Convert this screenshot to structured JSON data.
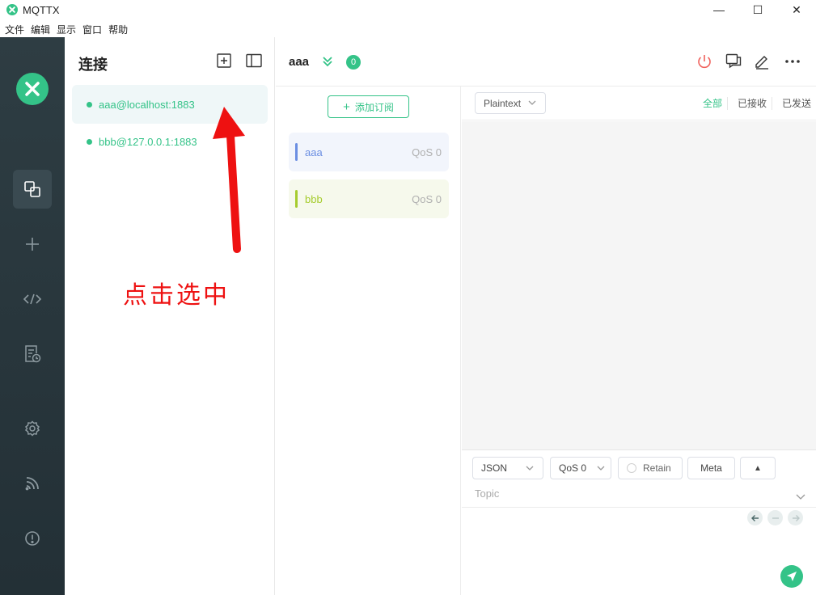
{
  "window": {
    "title": "MQTTX",
    "minimize": "—",
    "maximize": "☐",
    "close": "✕"
  },
  "menu": [
    "文件",
    "编辑",
    "显示",
    "窗口",
    "帮助"
  ],
  "sidebar": {
    "items": [
      "connections-icon",
      "add-icon",
      "script-icon",
      "log-icon",
      "settings-icon",
      "feed-icon",
      "about-icon"
    ]
  },
  "connections": {
    "title": "连接",
    "items": [
      {
        "label": "aaa@localhost:1883",
        "active": true
      },
      {
        "label": "bbb@127.0.0.1:1883",
        "active": false
      }
    ]
  },
  "annotation": {
    "text": "点击选中",
    "color": "#ee1111"
  },
  "main": {
    "title": "aaa",
    "badge": "0",
    "add_subscription": "添加订阅",
    "subscriptions": [
      {
        "topic": "aaa",
        "qos": "QoS 0",
        "color": "#6b8ee2",
        "bg": "#f2f5fc"
      },
      {
        "topic": "bbb",
        "qos": "QoS 0",
        "color": "#a6cc2e",
        "bg": "#f6f9ec"
      }
    ],
    "format": "Plaintext",
    "filters": {
      "all": "全部",
      "received": "已接收",
      "sent": "已发送"
    }
  },
  "composer": {
    "payload_type": "JSON",
    "qos": "QoS 0",
    "retain": "Retain",
    "meta": "Meta",
    "expand": "▲",
    "topic_placeholder": "Topic"
  },
  "colors": {
    "accent": "#34c388",
    "sidebar": "#2e3d43"
  }
}
